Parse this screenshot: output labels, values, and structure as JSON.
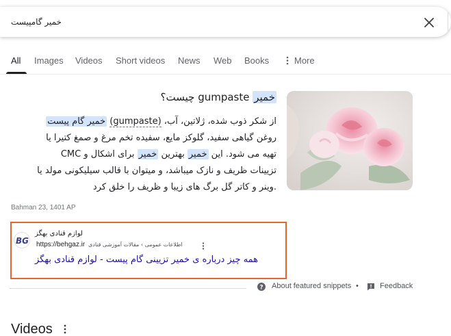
{
  "search": {
    "query": "خمیر گامپیست"
  },
  "tabs": [
    {
      "label": "All"
    },
    {
      "label": "Images"
    },
    {
      "label": "Videos"
    },
    {
      "label": "Short videos"
    },
    {
      "label": "News"
    },
    {
      "label": "Web"
    },
    {
      "label": "Books"
    },
    {
      "label": "More"
    }
  ],
  "snippet": {
    "title_highlight": "خمیر",
    "title_rest": "gumpaste چیست؟",
    "line1_pre": "از شکر ذوب شده، ژلاتین، آب، ",
    "line1_paren": "(gumpaste)",
    "line1_hl": "خمیر گام پیست",
    "line2": "روغن گیاهی سفید، گلوکز مایع، سفیده تخم مرغ و صمغ کتیرا یا",
    "line3_a": "تهیه می شود. این ",
    "line3_hl1": "خمیر",
    "line3_b": " بهترین ",
    "line3_hl2": "خمیر",
    "line3_c": " برای اشکال و CMC",
    "line4": "تزیینات ظریف و نازک میباشد، و میتوان با قالب سیلیکونی مولد یا",
    "line5": ".وینر و کاتر گل برگ های زیبا و ظریف را خلق کرد",
    "date": "Bahman 23, 1401 AP"
  },
  "source": {
    "site_name": "لوازم قنادی بهگز",
    "url": "https://behgaz.ir",
    "crumb": "اطلاعات عمومی › مقالات آموزشی قنادی",
    "favicon_text": "BG",
    "link_title": "همه چیز درباره ی خمیر تزیینی گام پیست - لوازم قنادی بهگز"
  },
  "footer": {
    "about": "About featured snippets",
    "separator": "•",
    "feedback": "Feedback"
  },
  "videos": {
    "title": "Videos"
  },
  "colors": {
    "highlight": "#d2e3fc",
    "link": "#1a0dab",
    "annotation_box": "#e4662c"
  }
}
